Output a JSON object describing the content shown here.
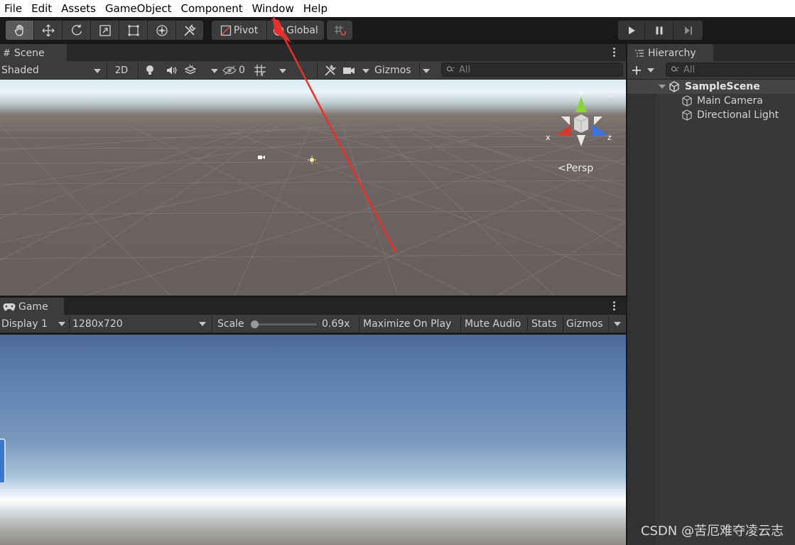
{
  "menu": [
    "File",
    "Edit",
    "Assets",
    "GameObject",
    "Component",
    "Window",
    "Help"
  ],
  "toolbar": {
    "tools": [
      "hand-tool-icon",
      "move-tool-icon",
      "rotate-tool-icon",
      "scale-tool-icon",
      "rect-tool-icon",
      "transform-tool-icon",
      "custom-editor-tool-icon"
    ],
    "pivot_label": "Pivot",
    "global_label": "Global",
    "play_controls": [
      "play-icon",
      "pause-icon",
      "step-icon"
    ]
  },
  "scene": {
    "tab_label": "Scene",
    "draw_mode": "Shaded",
    "mode_2d": "2D",
    "hidden_count": "0",
    "gizmos_label": "Gizmos",
    "search_placeholder": "All",
    "gizmo_axes": {
      "x": "x",
      "y": "y",
      "z": "z"
    },
    "projection_label": "Persp"
  },
  "game": {
    "tab_label": "Game",
    "display": "Display 1",
    "resolution": "1280x720",
    "scale_label": "Scale",
    "scale_value": "0.69x",
    "scale_fraction": 0.0,
    "maximize_label": "Maximize On Play",
    "mute_label": "Mute Audio",
    "stats_label": "Stats",
    "gizmos_label": "Gizmos"
  },
  "hierarchy": {
    "tab_label": "Hierarchy",
    "search_placeholder": "All",
    "scene_name": "SampleScene",
    "items": [
      "Main Camera",
      "Directional Light"
    ]
  },
  "watermark": "CSDN @苦厄难夺凌云志",
  "colors": {
    "annotation_arrow": "#e8302a",
    "axis_x": "#d23a2a",
    "axis_y": "#8ad43a",
    "axis_z": "#3a74e0"
  }
}
